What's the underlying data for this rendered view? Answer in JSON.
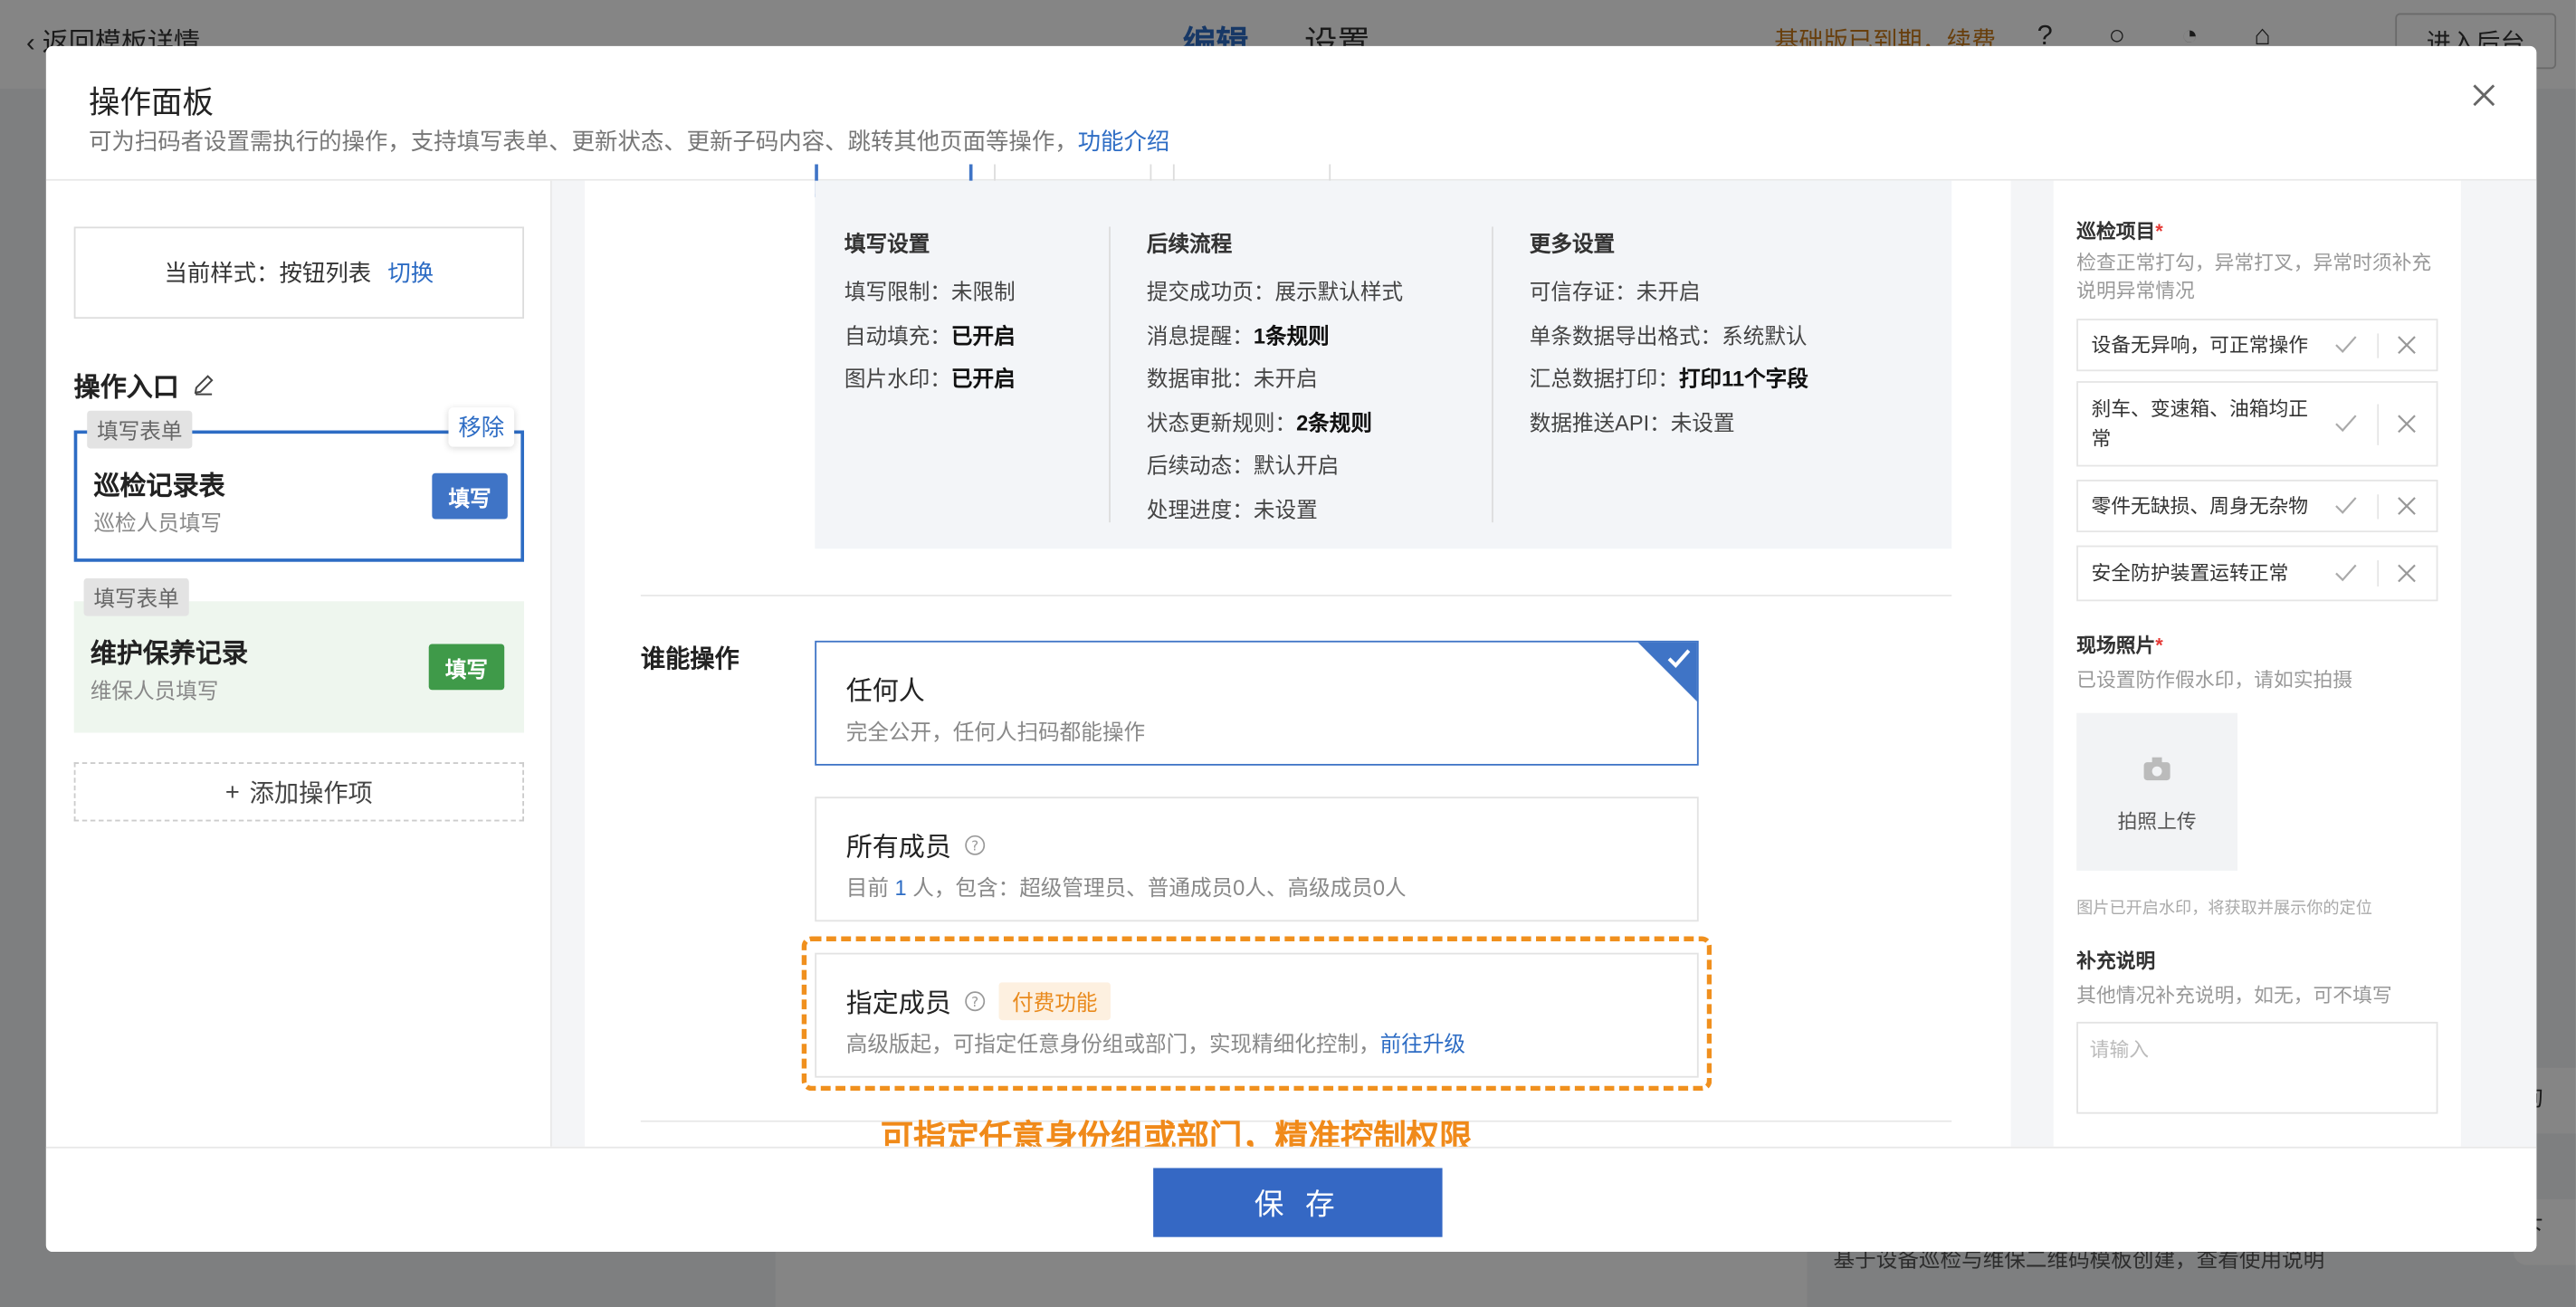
{
  "background": {
    "back_label": "返回模板详情",
    "tabs": [
      "编辑",
      "设置"
    ],
    "expire_text": "基础版已到期，续费",
    "enter_button": "进入后台",
    "bottom_text": "基于设备巡检与维保二维码模板创建，查看使用说明",
    "side_a": "询",
    "side_b": "下"
  },
  "modal": {
    "title": "操作面板",
    "description": "可为扫码者设置需执行的操作，支持填写表单、更新状态、更新子码内容、跳转其他页面等操作，",
    "description_link": "功能介绍",
    "close_icon": "close-icon"
  },
  "left": {
    "style_label": "当前样式：按钮列表",
    "switch_link": "切换",
    "section_title": "操作入口",
    "edit_icon": "pencil-icon",
    "ops": [
      {
        "tag": "填写表单",
        "name": "巡检记录表",
        "sub": "巡检人员填写",
        "button": "填写",
        "remove": "移除",
        "color": "#3f74c6"
      },
      {
        "tag": "填写表单",
        "name": "维护保养记录",
        "sub": "维保人员填写",
        "button": "填写",
        "color": "#3f9a49"
      }
    ],
    "add_label": "添加操作项"
  },
  "center": {
    "cols": [
      {
        "title": "填写设置",
        "rows": [
          {
            "k": "填写限制：",
            "v": "未限制",
            "bold": false
          },
          {
            "k": "自动填充：",
            "v": "已开启",
            "bold": true
          },
          {
            "k": "图片水印：",
            "v": "已开启",
            "bold": true
          }
        ]
      },
      {
        "title": "后续流程",
        "rows": [
          {
            "k": "提交成功页：",
            "v": "展示默认样式",
            "bold": false
          },
          {
            "k": "消息提醒：",
            "v": "1条规则",
            "bold": true
          },
          {
            "k": "数据审批：",
            "v": "未开启",
            "bold": false
          },
          {
            "k": "状态更新规则：",
            "v": "2条规则",
            "bold": true
          },
          {
            "k": "后续动态：",
            "v": "默认开启",
            "bold": false
          },
          {
            "k": "处理进度：",
            "v": "未设置",
            "bold": false
          }
        ]
      },
      {
        "title": "更多设置",
        "rows": [
          {
            "k": "可信存证：",
            "v": "未开启",
            "bold": false
          },
          {
            "k": "单条数据导出格式：",
            "v": "系统默认",
            "bold": false
          },
          {
            "k": "汇总数据打印：",
            "v": "打印11个字段",
            "bold": true
          },
          {
            "k": "数据推送API：",
            "v": "未设置",
            "bold": false
          }
        ]
      }
    ],
    "who_label": "谁能操作",
    "options": {
      "anyone_title": "任何人",
      "anyone_desc": "完全公开，任何人扫码都能操作",
      "members_title": "所有成员",
      "members_desc_prefix": "目前",
      "members_count": "1",
      "members_desc_suffix": "人，包含：超级管理员、普通成员0人、高级成员0人",
      "specified_title": "指定成员",
      "paid_badge": "付费功能",
      "specified_desc": "高级版起，可指定任意身份组或部门，实现精细化控制，",
      "upgrade_link": "前往升级"
    },
    "callout": "可指定任意身份组或部门，精准控制权限"
  },
  "right": {
    "inspect_title": "巡检项目",
    "inspect_desc": "检查正常打勾，异常打叉，异常时须补充说明异常情况",
    "items": [
      "设备无异响，可正常操作",
      "刹车、变速箱、油箱均正常",
      "零件无缺损、周身无杂物",
      "安全防护装置运转正常"
    ],
    "photo_title": "现场照片",
    "photo_desc": "已设置防作假水印，请如实拍摄",
    "upload_label": "拍照上传",
    "photo_note": "图片已开启水印，将获取并展示你的定位",
    "extra_title": "补充说明",
    "extra_desc": "其他情况补充说明，如无，可不填写",
    "extra_placeholder": "请输入"
  },
  "footer": {
    "save_label": "保 存"
  },
  "colors": {
    "primary": "#3568c4",
    "accent": "#f0901e",
    "green": "#3f9a49"
  }
}
